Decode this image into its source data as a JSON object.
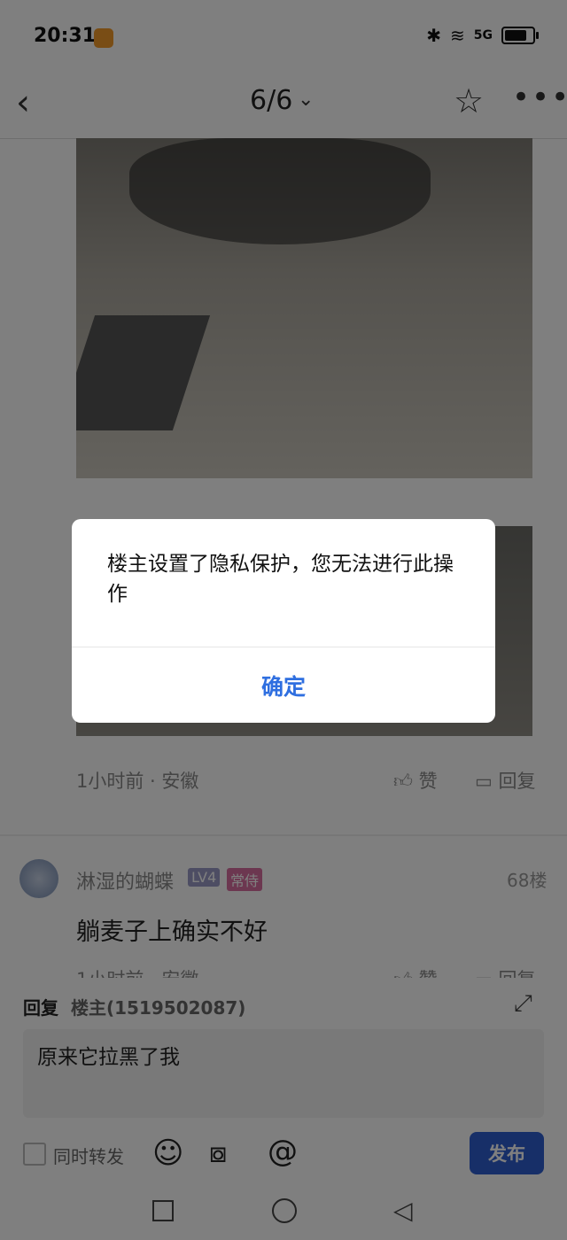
{
  "status_bar": {
    "time": "20:31",
    "signal_text": "5G"
  },
  "header": {
    "page_indicator": "6/6"
  },
  "post": {
    "meta": "1小时前 · 安徽",
    "like_label": "赞",
    "reply_label": "回复"
  },
  "comment": {
    "username": "淋湿的蝴蝶",
    "level": "LV4",
    "tag": "常侍",
    "floor": "68楼",
    "text": "躺麦子上确实不好",
    "meta": "1小时前 · 安徽",
    "like_label": "赞",
    "reply_label": "回复"
  },
  "reply_panel": {
    "reply_label": "回复",
    "reply_target": "楼主(1519502087)",
    "input_value": "原来它拉黑了我",
    "forward_label": "同时转发",
    "publish_label": "发布"
  },
  "dialog": {
    "message": "楼主设置了隐私保护，您无法进行此操作",
    "ok_label": "确定"
  },
  "icons": {
    "back": "back-icon",
    "dropdown": "chevron-down-icon",
    "favorite": "star-icon",
    "more": "more-icon",
    "like": "thumbs-up-icon",
    "reply": "comment-icon",
    "expand": "expand-icon",
    "emoji": "emoji-icon",
    "image": "camera-icon",
    "mention": "at-icon"
  },
  "colors": {
    "accent": "#2f5fd0",
    "dialog_button": "#2f6fe0"
  }
}
